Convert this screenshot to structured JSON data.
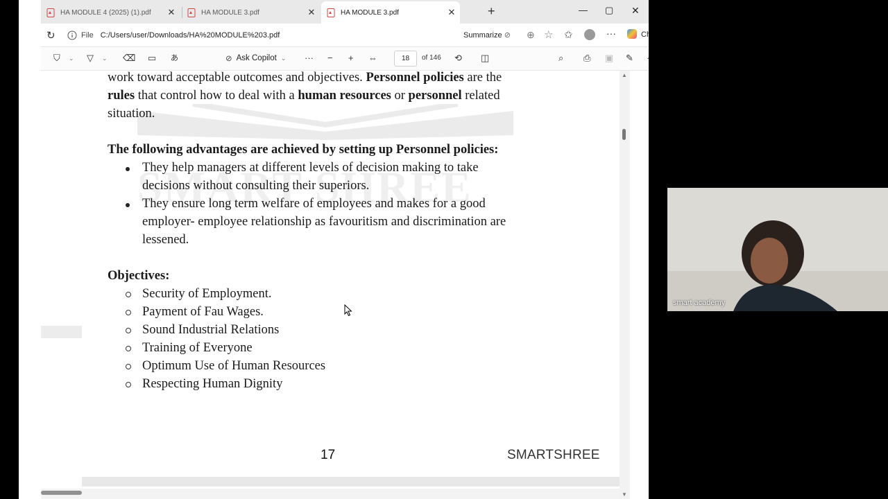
{
  "tabs": [
    {
      "label": "HA MODULE 4 (2025) (1).pdf",
      "active": false
    },
    {
      "label": "HA MODULE 3.pdf",
      "active": false
    },
    {
      "label": "HA MODULE 3.pdf",
      "active": true
    }
  ],
  "address": {
    "scheme_label": "File",
    "url": "C:/Users/user/Downloads/HA%20MODULE%203.pdf",
    "summarize_label": "Summarize",
    "chat_label": "Chat"
  },
  "pdf_toolbar": {
    "ask_copilot_label": "Ask Copilot",
    "current_page": "18",
    "total_pages_label": "of 146"
  },
  "document": {
    "intro_line1_a": "work toward acceptable outcomes and objectives. ",
    "intro_line1_b": "Personnel policies",
    "intro_line1_c": " are the",
    "intro_line2_a": "rules",
    "intro_line2_b": " that control  how to deal with a ",
    "intro_line2_c": "human resources",
    "intro_line2_d": " or ",
    "intro_line2_e": "personnel",
    "intro_line2_f": " related",
    "intro_line3": "situation.",
    "advantages_heading": "The following advantages are achieved by setting up Personnel policies:",
    "adv1_line1": "They help managers at different levels of decision making to take",
    "adv1_line2": "decisions without consulting their superiors.",
    "adv2_line1": "They ensure long term welfare of employees and makes for a good",
    "adv2_line2": "employer- employee relationship as favouritism and discrimination are",
    "adv2_line3": "lessened.",
    "objectives_heading": "Objectives:",
    "objectives": [
      "Security of Employment.",
      "Payment of Fau Wages.",
      "Sound Industrial Relations",
      "Training of Everyone",
      "Optimum Use of Human Resources",
      "Respecting Human Dignity"
    ],
    "watermark": "SMART SHREE",
    "page_number": "17",
    "footer_brand": "SMARTSHREE"
  },
  "webcam": {
    "participant_name": "smart academy"
  }
}
